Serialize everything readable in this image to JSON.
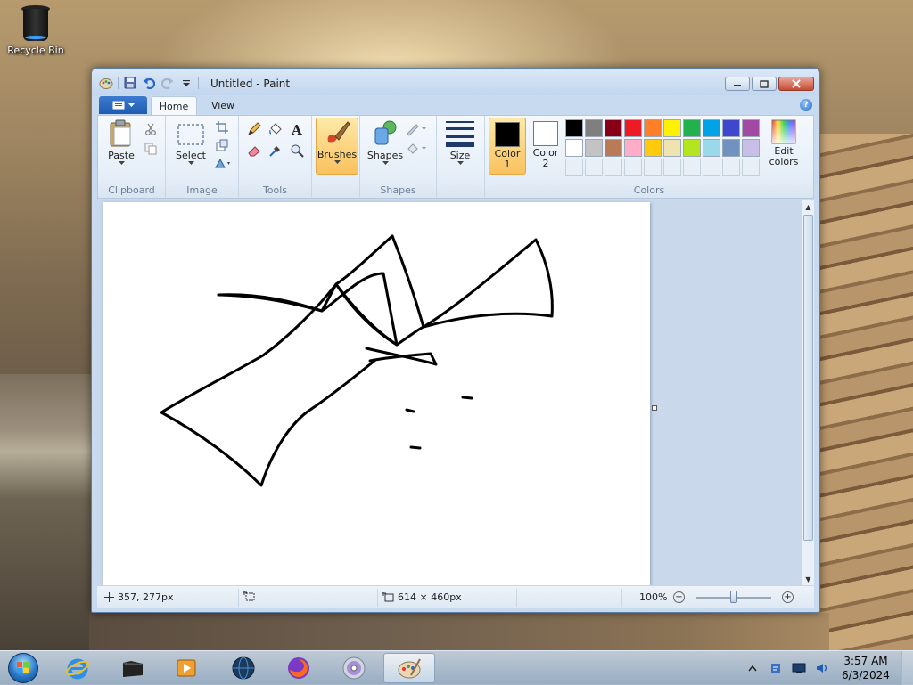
{
  "desktop": {
    "icons": [
      {
        "label": "Recycle Bin"
      }
    ]
  },
  "window": {
    "title": "Untitled - Paint"
  },
  "tabs": {
    "home": "Home",
    "view": "View"
  },
  "ribbon": {
    "clipboard": {
      "group_label": "Clipboard",
      "paste": "Paste"
    },
    "image": {
      "group_label": "Image",
      "select": "Select"
    },
    "tools": {
      "group_label": "Tools"
    },
    "brushes": {
      "label": "Brushes"
    },
    "shapes": {
      "group_label": "Shapes",
      "shapes": "Shapes"
    },
    "size": {
      "label": "Size"
    },
    "colors": {
      "group_label": "Colors",
      "color1_label": "Color",
      "color1_num": "1",
      "color2_label": "Color",
      "color2_num": "2",
      "edit_line1": "Edit",
      "edit_line2": "colors",
      "color1_value": "#000000",
      "color2_value": "#ffffff",
      "palette_row1": [
        "#000000",
        "#7f7f7f",
        "#880015",
        "#ed1c24",
        "#ff7f27",
        "#fff200",
        "#22b14c",
        "#00a2e8",
        "#3f48cc",
        "#a349a4"
      ],
      "palette_row2": [
        "#ffffff",
        "#c3c3c3",
        "#b97a57",
        "#ffaec9",
        "#ffc90e",
        "#efe4b0",
        "#b5e61d",
        "#99d9ea",
        "#7092be",
        "#c8bfe7"
      ]
    }
  },
  "status": {
    "cursor_pos": "357, 277px",
    "canvas_size": "614 × 460px",
    "zoom": "100%"
  },
  "taskbar": {
    "clock_time": "3:57 AM",
    "clock_date": "6/3/2024"
  }
}
